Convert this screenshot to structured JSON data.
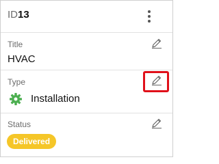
{
  "header": {
    "id_prefix": "ID",
    "id_value": "13",
    "menu_icon": "kebab-vertical-icon"
  },
  "fields": {
    "title": {
      "label": "Title",
      "value": "HVAC",
      "edit_icon": "pencil-icon"
    },
    "type": {
      "label": "Type",
      "value": "Installation",
      "icon": "gear-icon",
      "icon_color": "#4caf50",
      "edit_icon": "pencil-icon"
    },
    "status": {
      "label": "Status",
      "value": "Delivered",
      "badge_color": "#f5c628",
      "edit_icon": "pencil-icon"
    }
  },
  "colors": {
    "highlight_outline": "#e0101a"
  }
}
